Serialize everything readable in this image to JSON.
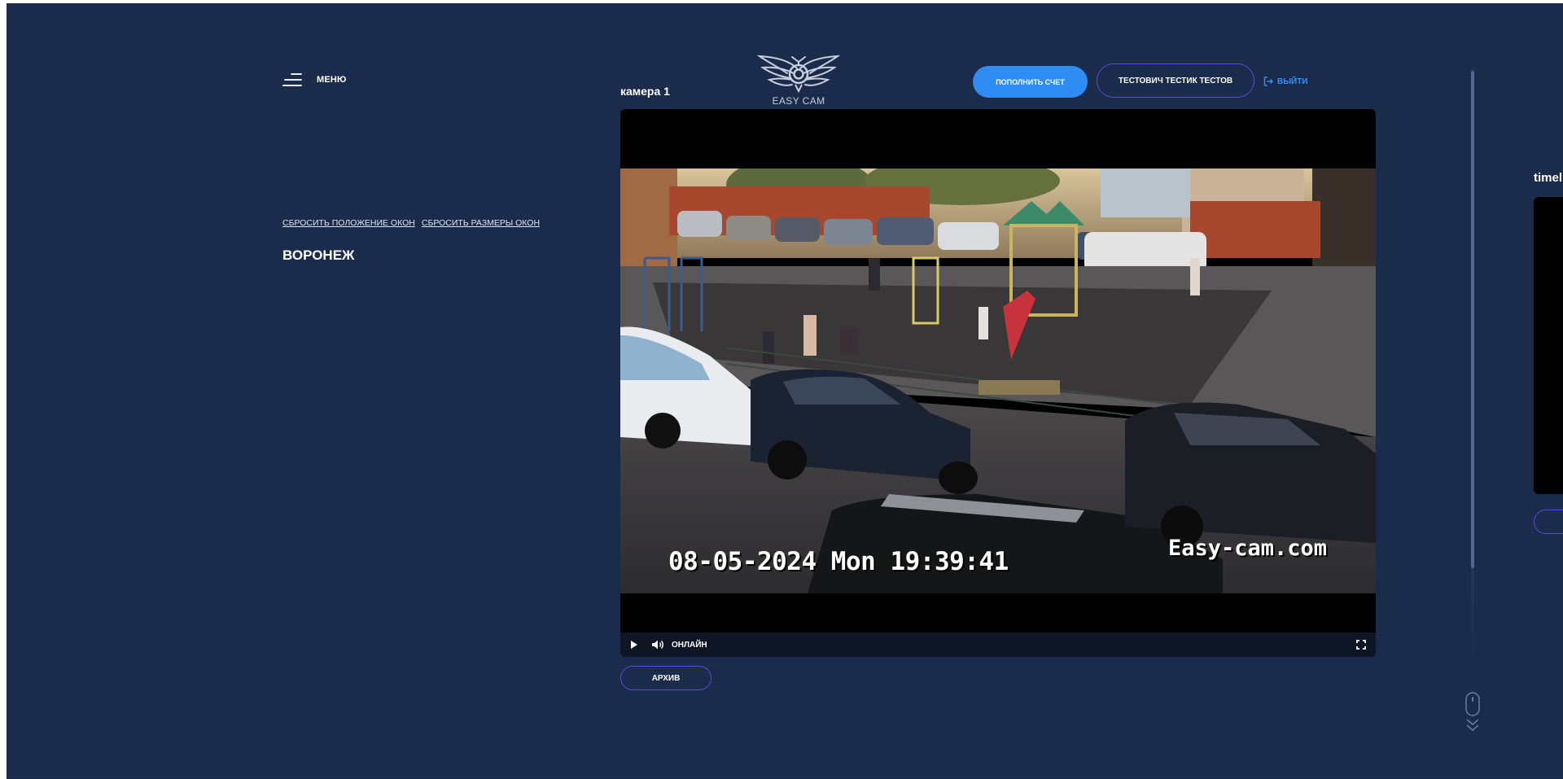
{
  "header": {
    "menu_label": "МЕНЮ",
    "logo_text": "EASY CAM",
    "pay_button": "ПОПОЛНИТЬ СЧЕТ",
    "user_button": "ТЕСТОВИЧ ТЕСТИК ТЕСТОВ",
    "logout": "ВЫЙТИ"
  },
  "sidebar": {
    "reset_position": "СБРОСИТЬ ПОЛОЖЕНИЕ ОКОН",
    "reset_size": "СБРОСИТЬ РАЗМЕРЫ ОКОН",
    "city": "ВОРОНЕЖ"
  },
  "camera": {
    "title": "камера 1",
    "osd_timestamp": "08-05-2024 Mon 19:39:41",
    "osd_brand": "Easy-cam.com",
    "status": "ОНЛАЙН",
    "archive_button": "АРХИВ"
  },
  "timeline": {
    "title": "timeline"
  },
  "icons": {
    "menu": "hamburger-icon",
    "logout": "logout-icon",
    "play": "play-icon",
    "volume": "volume-icon",
    "fullscreen": "fullscreen-icon",
    "scroll": "mouse-scroll-icon"
  },
  "colors": {
    "background": "#1a2a4a",
    "accent_blue": "#2f8cf3",
    "outline_purple": "#5b48d6",
    "link_blue": "#3a8ff5"
  }
}
